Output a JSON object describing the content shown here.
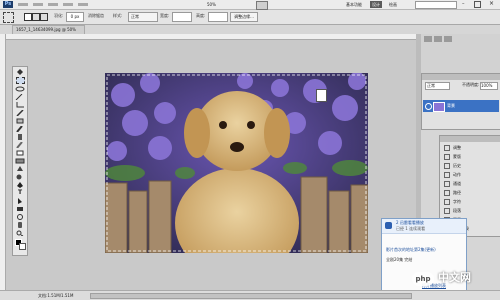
{
  "menu": {
    "app_badge": "Ps",
    "basic_function": "基本功能",
    "design": "设计",
    "paint": "绘画",
    "zoom": "50%",
    "adjust_edge": "调整边缘..."
  },
  "options": {
    "feather_label": "羽化:",
    "feather_value": "0 px",
    "antialias_label": "消除锯齿",
    "style_label": "样式:",
    "style_value": "正常",
    "width_label": "宽度:",
    "height_label": "高度:"
  },
  "document": {
    "tab_title": "1657_1_14634099.jpg @ 50%(RGB/8)",
    "doc_info": "文档:1.51M/1.51M"
  },
  "layers": {
    "mode": "正常",
    "opacity_label": "不透明度:",
    "opacity": "100%",
    "layer_name": "背景"
  },
  "adjust_panel": {
    "items": [
      "调整",
      "蒙版",
      "历史",
      "动作",
      "通道",
      "路径",
      "字符",
      "段落",
      "图层",
      "历史记录"
    ]
  },
  "popup": {
    "title": "2 迅雷看看播放",
    "subtitle": "已经 1 连续观看",
    "line1": "影片首次的地址第2集(更新)",
    "line2": "全剧20集 完结",
    "link": "打开播放列表"
  },
  "watermark": {
    "text": "中文网",
    "badge": "php"
  },
  "colors": {
    "menubar": "#ececec",
    "panel": "#e2e2e2",
    "selection": "#3b72c4"
  }
}
